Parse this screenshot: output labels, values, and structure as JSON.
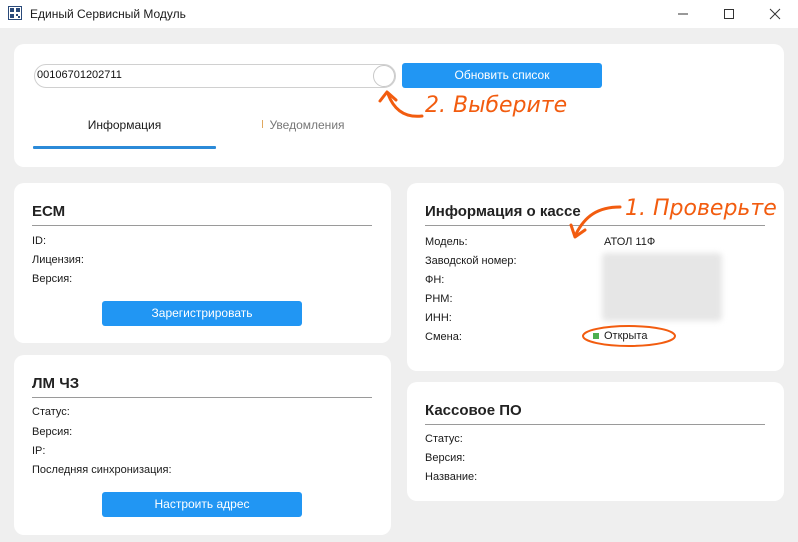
{
  "window": {
    "title": "Единый Сервисный Модуль",
    "icon": "app-logo-icon"
  },
  "toolbar": {
    "serial_value": "00106701202711",
    "refresh_label": "Обновить список"
  },
  "tabs": [
    {
      "label": "Информация",
      "active": true
    },
    {
      "label": "Уведомления",
      "active": false
    }
  ],
  "ecm": {
    "title": "ЕСМ",
    "rows": [
      {
        "label": "ID:",
        "value": ""
      },
      {
        "label": "Лицензия:",
        "value": ""
      },
      {
        "label": "Версия:",
        "value": ""
      }
    ],
    "button_label": "Зарегистрировать"
  },
  "lm": {
    "title": "ЛМ ЧЗ",
    "rows": [
      {
        "label": "Статус:",
        "value": ""
      },
      {
        "label": "Версия:",
        "value": ""
      },
      {
        "label": "IP:",
        "value": ""
      },
      {
        "label": "Последняя синхронизация:",
        "value": ""
      }
    ],
    "button_label": "Настроить адрес"
  },
  "kkt": {
    "title": "Информация о кассе",
    "rows": [
      {
        "label": "Модель:",
        "value": "АТОЛ 11Ф"
      },
      {
        "label": "Заводской номер:",
        "value": ""
      },
      {
        "label": "ФН:",
        "value": ""
      },
      {
        "label": "РНМ:",
        "value": ""
      },
      {
        "label": "ИНН:",
        "value": ""
      },
      {
        "label": "Смена:",
        "value": "Открыта"
      }
    ],
    "status_color": "#4caf50"
  },
  "po": {
    "title": "Кассовое ПО",
    "rows": [
      {
        "label": "Статус:",
        "value": ""
      },
      {
        "label": "Версия:",
        "value": ""
      },
      {
        "label": "Название:",
        "value": ""
      }
    ]
  },
  "annotations": {
    "step1": "1. Проверьте",
    "step2": "2. Выберите",
    "color": "#f25c0f"
  },
  "colors": {
    "accent": "#2196f3",
    "tab_underline": "#2b8ad8",
    "background": "#efefef"
  }
}
